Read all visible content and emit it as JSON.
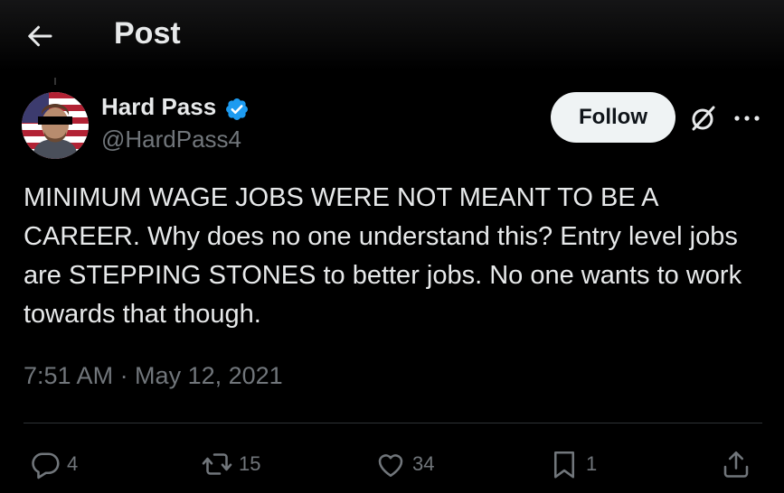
{
  "header": {
    "title": "Post",
    "back_icon": "arrow-left-icon"
  },
  "author": {
    "display_name": "Hard Pass",
    "handle": "@HardPass4",
    "verified": true,
    "verified_color": "#1d9bf0",
    "avatar_icon": "avatar-flag-portrait"
  },
  "follow_button": {
    "label": "Follow"
  },
  "tweet": {
    "text": "MINIMUM WAGE JOBS WERE NOT MEANT TO BE A CAREER. Why does no one understand this? Entry level jobs are STEPPING STONES to better jobs. No one wants to work towards that though.",
    "timestamp": "7:51 AM · May 12, 2021"
  },
  "actions": {
    "replies": "4",
    "reposts": "15",
    "likes": "34",
    "bookmarks": "1"
  },
  "colors": {
    "background": "#000000",
    "text": "#e7e9ea",
    "secondary": "#71767b",
    "divider": "#2f3336",
    "button_bg": "#eff3f4"
  }
}
